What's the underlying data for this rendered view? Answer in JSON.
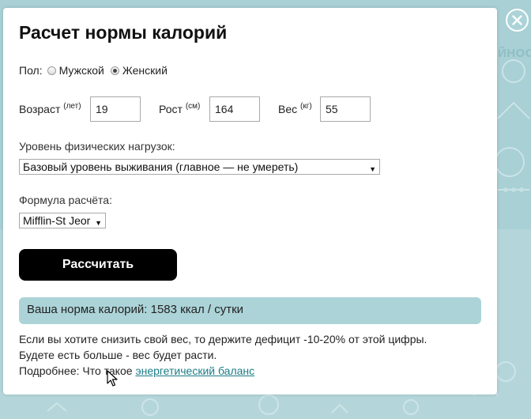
{
  "modal": {
    "title": "Расчет нормы калорий",
    "background_text": "ЙНОСТ"
  },
  "gender": {
    "label": "Пол:",
    "options": [
      {
        "label": "Мужской",
        "checked": false
      },
      {
        "label": "Женский",
        "checked": true
      }
    ]
  },
  "params": {
    "age": {
      "label": "Возраст",
      "unit": "(лет)",
      "value": "19"
    },
    "height": {
      "label": "Рост",
      "unit": "(см)",
      "value": "164"
    },
    "weight": {
      "label": "Вес",
      "unit": "(кг)",
      "value": "55"
    }
  },
  "activity": {
    "label": "Уровень физических нагрузок:",
    "selected": "Базовый уровень выживания (главное — не умереть)"
  },
  "formula": {
    "label": "Формула расчёта:",
    "selected": "Mifflin-St Jeor"
  },
  "calculate_label": "Рассчитать",
  "result": {
    "text": "Ваша норма калорий: 1583 ккал / сутки"
  },
  "notes": {
    "line1": "Если вы хотите снизить свой вес, то держите дефицит -10-20% от этой цифры.",
    "line2": "Будете есть больше - вес будет расти.",
    "line3_prefix": "Подробнее: Что такое ",
    "line3_link": "энергетический баланс"
  },
  "colors": {
    "accent": "#acd4d8",
    "link": "#1a7c86",
    "button": "#000000"
  },
  "icons": {
    "close": "close-icon",
    "dropdown": "chevron-down-icon",
    "cursor": "mouse-cursor-icon"
  }
}
